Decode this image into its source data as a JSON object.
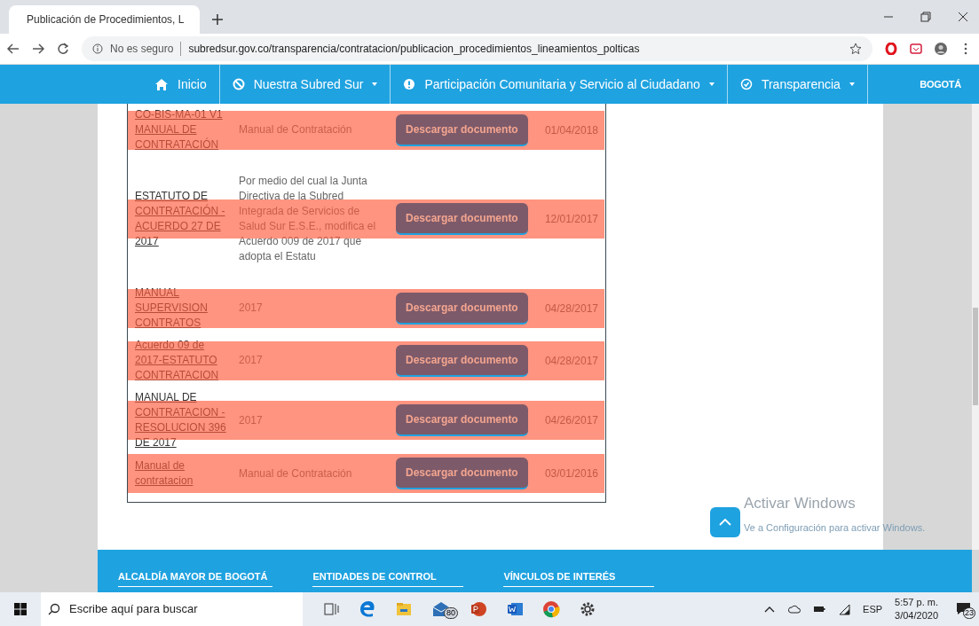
{
  "browser": {
    "tab_title": "Publicación de Procedimientos, L",
    "url_security": "No es seguro",
    "url": "subredsur.gov.co/transparencia/contratacion/publicacion_procedimientos_lineamientos_polticas"
  },
  "nav": {
    "items": [
      {
        "label": "Inicio",
        "kind": "home",
        "dropdown": false
      },
      {
        "label": "Nuestra Subred Sur",
        "kind": "ban",
        "dropdown": true
      },
      {
        "label": "Participación Comunitaria y Servicio al Ciudadano",
        "kind": "info",
        "dropdown": true
      },
      {
        "label": "Transparencia",
        "kind": "check",
        "dropdown": true
      }
    ],
    "logo": "BOGOTÁ"
  },
  "documents": [
    {
      "name": "CO-BIS-MA-01 V1 MANUAL DE CONTRATACIÓN",
      "description": "Manual de Contratación",
      "button": "Descargar documento",
      "date": "01/04/2018",
      "highlighted": true
    },
    {
      "name": "ESTATUTO DE CONTRATACIÓN - ACUERDO 27 DE 2017",
      "description": "Por medio del cual la Junta Directiva de la Subred Integrada de Servicios de Salud Sur E.S.E., modifica el Acuerdo 009 de 2017 que adopta el Estatu",
      "button": "Descargar documento",
      "date": "12/01/2017",
      "highlighted": true
    },
    {
      "name": "MANUAL SUPERVISION CONTRATOS",
      "description": "2017",
      "button": "Descargar documento",
      "date": "04/28/2017",
      "highlighted": true
    },
    {
      "name": "Acuerdo 09 de 2017-ESTATUTO CONTRATACION",
      "description": "2017",
      "button": "Descargar documento",
      "date": "04/28/2017",
      "highlighted": true
    },
    {
      "name": "MANUAL DE CONTRATACION - RESOLUCION 396 DE 2017",
      "description": "2017",
      "button": "Descargar documento",
      "date": "04/26/2017",
      "highlighted": true
    },
    {
      "name": "Manual de contratacion",
      "description": "Manual de Contratación",
      "button": "Descargar documento",
      "date": "03/01/2016",
      "highlighted": true
    }
  ],
  "footer": {
    "headings": [
      "ALCALDÍA MAYOR DE BOGOTÁ",
      "ENTIDADES DE CONTROL",
      "VÍNCULOS DE INTERÉS"
    ]
  },
  "activation": {
    "title": "Activar Windows",
    "subtitle": "Ve a Configuración para activar Windows."
  },
  "taskbar": {
    "search_placeholder": "Escribe aquí para buscar",
    "mail_badge": "80",
    "language": "ESP",
    "time": "5:57 p. m.",
    "date": "3/04/2020",
    "notifications": "23"
  }
}
